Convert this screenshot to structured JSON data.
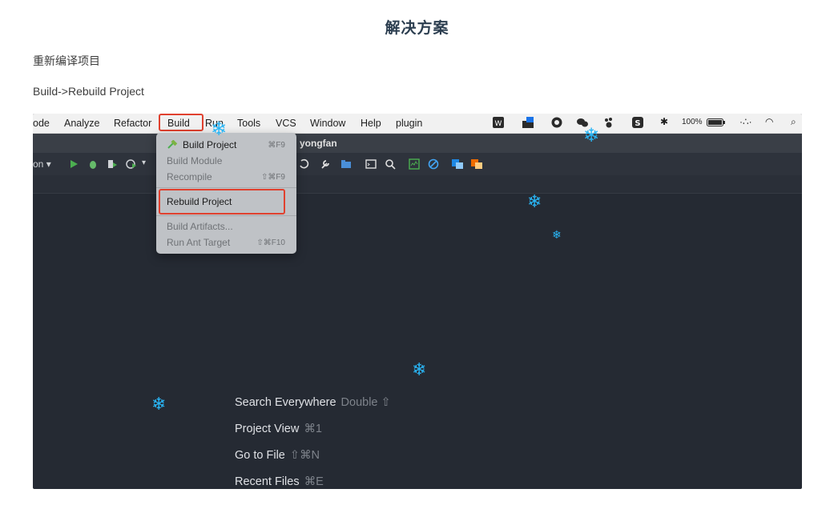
{
  "article": {
    "title": "解决方案",
    "para1": "重新编译项目",
    "para2": "Build->Rebuild Project"
  },
  "menubar": {
    "items": [
      "ode",
      "Analyze",
      "Refactor",
      "Build",
      "Run",
      "Tools",
      "VCS",
      "Window",
      "Help",
      "plugin"
    ],
    "battery": "100%"
  },
  "ide": {
    "project_name": "yongfan",
    "run_config": "on"
  },
  "build_menu": {
    "build_project": {
      "label": "Build Project",
      "shortcut": "⌘F9"
    },
    "build_module": {
      "label": "Build Module"
    },
    "recompile": {
      "label": "Recompile",
      "shortcut": "⇧⌘F9"
    },
    "rebuild_project": {
      "label": "Rebuild Project"
    },
    "build_artifacts": {
      "label": "Build Artifacts..."
    },
    "run_ant_target": {
      "label": "Run Ant Target",
      "shortcut": "⇧⌘F10"
    }
  },
  "hints": [
    {
      "label": "Search Everywhere",
      "key": "Double ⇧"
    },
    {
      "label": "Project View",
      "key": "⌘1"
    },
    {
      "label": "Go to File",
      "key": "⇧⌘N"
    },
    {
      "label": "Recent Files",
      "key": "⌘E"
    }
  ],
  "colors": {
    "highlight": "#e0412f",
    "accent_flake": "#29b6f6",
    "editor_bg": "#252a33"
  }
}
